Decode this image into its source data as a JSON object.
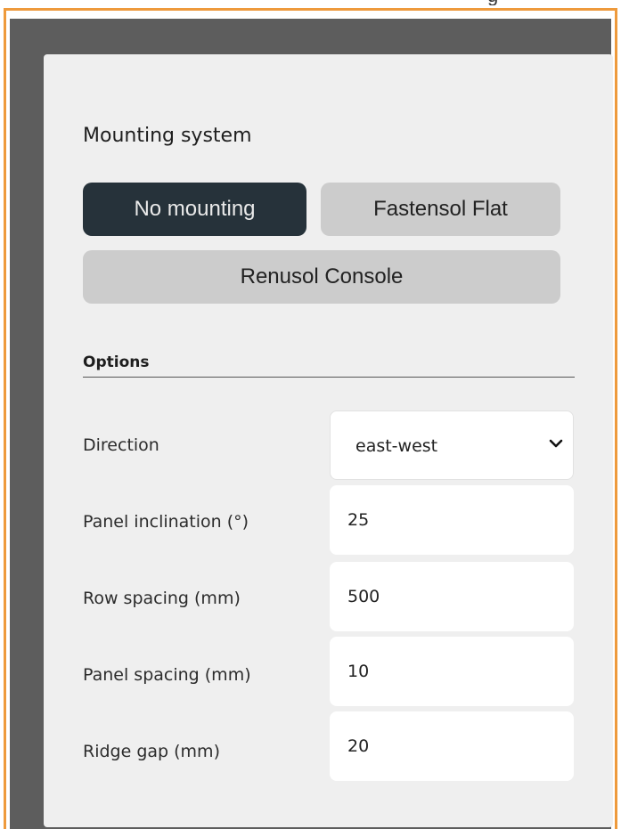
{
  "section_title": "Mounting system",
  "mounting_options": [
    {
      "label": "No mounting",
      "selected": true
    },
    {
      "label": "Fastensol Flat",
      "selected": false
    },
    {
      "label": "Renusol Console",
      "selected": false
    }
  ],
  "options": {
    "title": "Options",
    "direction": {
      "label": "Direction",
      "value": "east-west"
    },
    "panel_inclination": {
      "label": "Panel inclination (°)",
      "value": "25"
    },
    "row_spacing": {
      "label": "Row spacing (mm)",
      "value": "500"
    },
    "panel_spacing": {
      "label": "Panel spacing (mm)",
      "value": "10"
    },
    "ridge_gap": {
      "label": "Ridge gap (mm)",
      "value": "20"
    }
  },
  "colors": {
    "accent_border": "#ee9a3c",
    "active_button": "#26323a",
    "inactive_button": "#cccccc",
    "panel_bg": "#efefef"
  }
}
